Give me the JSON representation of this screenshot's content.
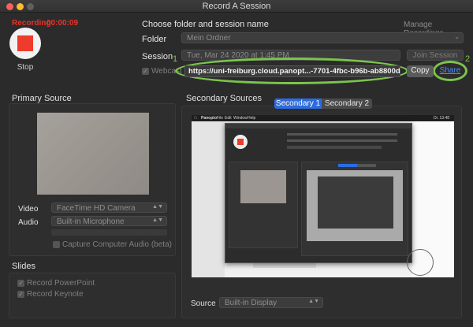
{
  "window": {
    "title": "Record A Session"
  },
  "recording": {
    "status_label": "Recording",
    "elapsed": "00:00:09",
    "stop_label": "Stop"
  },
  "folder_session": {
    "heading": "Choose folder and session name",
    "manage_label": "Manage Recordings",
    "folder_label": "Folder",
    "folder_value": "Mein Ordner",
    "session_label": "Session",
    "session_value": "Tue, Mar 24 2020 at 1:45 PM",
    "join_label": "Join Session",
    "webcast_label": "Webcast",
    "link_value": "https://uni-freiburg.cloud.panopt...-7701-4fbc-b96b-ab8800d3028e",
    "copy_label": "Copy",
    "share_label": "Share",
    "marker_1": "1",
    "marker_2": "2"
  },
  "primary": {
    "heading": "Primary Source",
    "video_label": "Video",
    "video_value": "FaceTime HD Camera",
    "audio_label": "Audio",
    "audio_value": "Built-in Microphone",
    "capture_audio_label": "Capture Computer Audio (beta)"
  },
  "slides": {
    "heading": "Slides",
    "items": [
      {
        "label": "Record PowerPoint"
      },
      {
        "label": "Record Keynote"
      }
    ]
  },
  "secondary": {
    "heading": "Secondary Sources",
    "tabs": [
      {
        "label": "Secondary 1"
      },
      {
        "label": "Secondary 2"
      }
    ],
    "source_label": "Source",
    "source_value": "Built-in Display"
  },
  "capture_preview": {
    "menubar_app": "Panopto",
    "menu_items": [
      "File",
      "Edit",
      "Window",
      "Help"
    ],
    "clock": "Di. 13:48"
  },
  "colors": {
    "record_red": "#e8322b",
    "accent_blue": "#2d6cdf",
    "annotation_green": "#7cc44e",
    "link_blue": "#4c8ef7"
  }
}
